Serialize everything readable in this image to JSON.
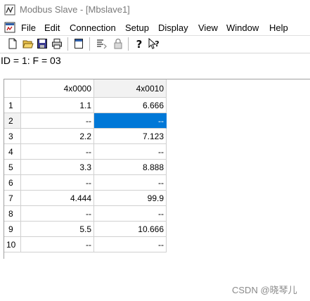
{
  "window": {
    "title": "Modbus Slave - [Mbslave1]"
  },
  "menu": [
    "File",
    "Edit",
    "Connection",
    "Setup",
    "Display",
    "View",
    "Window",
    "Help"
  ],
  "toolbar": [
    "new-icon",
    "open-icon",
    "save-icon",
    "print-icon",
    "window-icon",
    "list-icon",
    "lock-icon",
    "help-icon",
    "context-help-icon"
  ],
  "status": "ID = 1: F = 03",
  "grid": {
    "columns": [
      "4x0000",
      "4x0010"
    ],
    "rows": [
      {
        "num": "1",
        "c0": "1.1",
        "c1": "6.666"
      },
      {
        "num": "2",
        "c0": "--",
        "c1": "--"
      },
      {
        "num": "3",
        "c0": "2.2",
        "c1": "7.123"
      },
      {
        "num": "4",
        "c0": "--",
        "c1": "--"
      },
      {
        "num": "5",
        "c0": "3.3",
        "c1": "8.888"
      },
      {
        "num": "6",
        "c0": "--",
        "c1": "--"
      },
      {
        "num": "7",
        "c0": "4.444",
        "c1": "99.9"
      },
      {
        "num": "8",
        "c0": "--",
        "c1": "--"
      },
      {
        "num": "9",
        "c0": "5.5",
        "c1": "10.666"
      },
      {
        "num": "10",
        "c0": "--",
        "c1": "--"
      }
    ],
    "selected": {
      "row": 2,
      "column": "4x0010"
    }
  },
  "watermark": "CSDN @晓琴儿",
  "colors": {
    "selection": "#0078d7",
    "header_active": "#f2f2f2"
  }
}
